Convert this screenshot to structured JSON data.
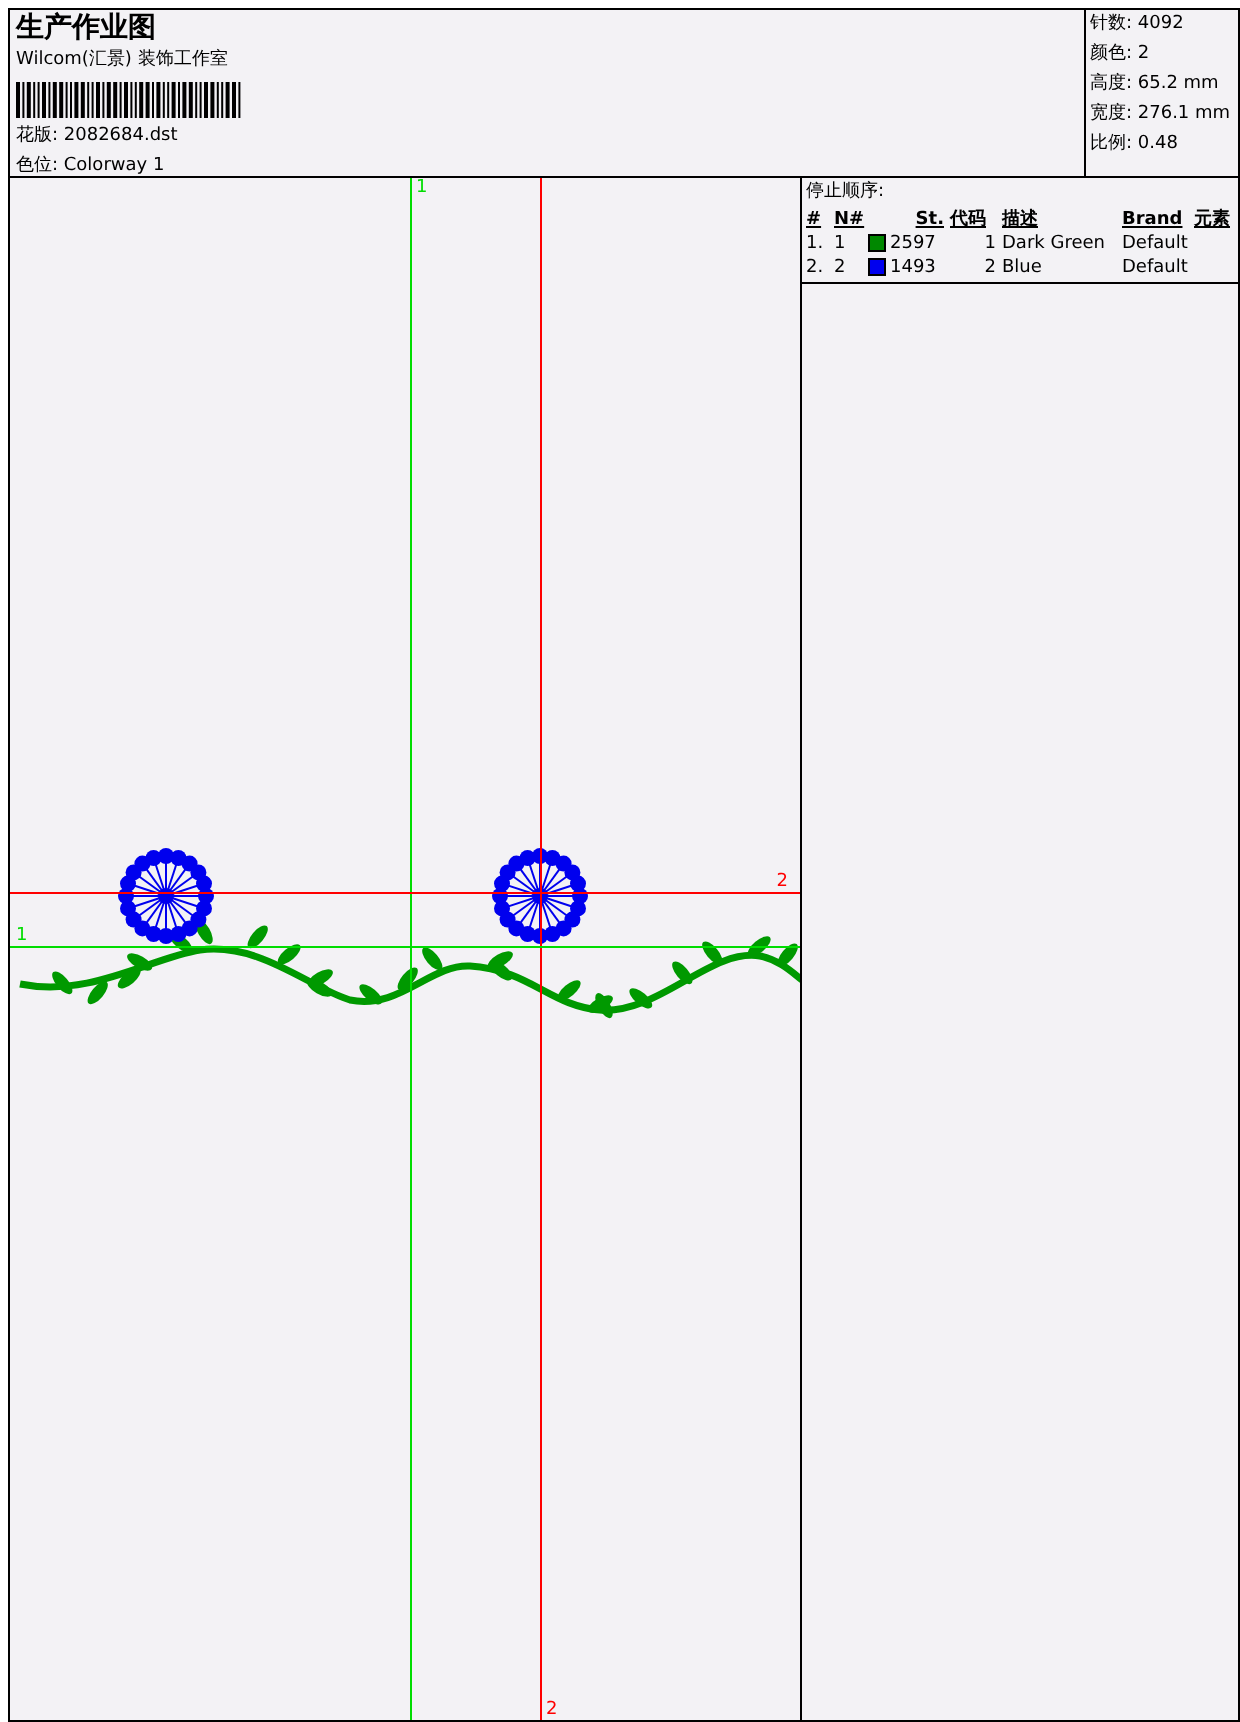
{
  "header": {
    "title": "生产作业图",
    "company": "Wilcom(汇景) 装饰工作室",
    "design": "花版: 2082684.dst",
    "colorway": "色位: Colorway 1"
  },
  "stats": [
    "针数: 4092",
    "颜色: 2",
    "高度: 65.2 mm",
    "宽度: 276.1 mm",
    "比例: 0.48"
  ],
  "stop_sequence": {
    "title": "停止顺序:",
    "columns": [
      "#",
      "N#",
      "St.",
      "代码",
      "描述",
      "Brand",
      "元素"
    ],
    "rows": [
      {
        "index": "1.",
        "needle": "1",
        "color": "#008800",
        "stitches": "2597",
        "code": "1",
        "description": "Dark Green",
        "brand": "Default"
      },
      {
        "index": "2.",
        "needle": "2",
        "color": "#0000ee",
        "stitches": "1493",
        "code": "2",
        "description": "Blue",
        "brand": "Default"
      }
    ]
  },
  "guides": [
    {
      "label": "1",
      "color": "#00dd00",
      "kind": "vertical"
    },
    {
      "label": "2",
      "color": "#ff0000",
      "kind": "vertical"
    },
    {
      "label": "2",
      "color": "#ff0000",
      "kind": "horizontal"
    },
    {
      "label": "1",
      "color": "#00dd00",
      "kind": "horizontal"
    }
  ]
}
